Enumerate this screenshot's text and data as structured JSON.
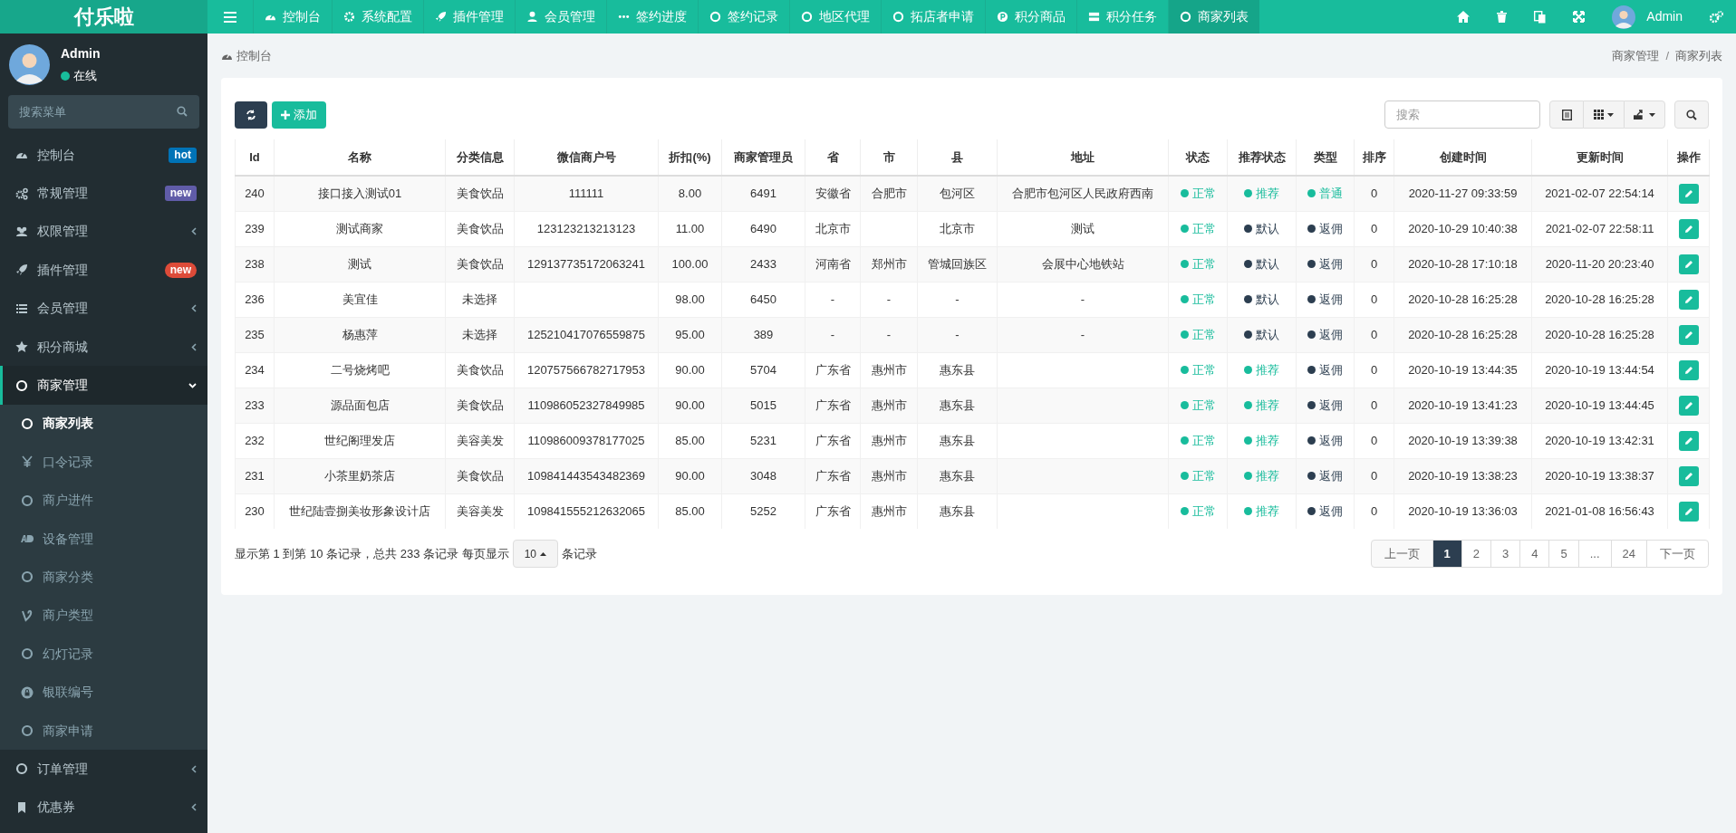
{
  "brand": "付乐啦",
  "topnav": [
    {
      "label": "控制台",
      "selected": false
    },
    {
      "label": "系统配置",
      "selected": false
    },
    {
      "label": "插件管理",
      "selected": false
    },
    {
      "label": "会员管理",
      "selected": false
    },
    {
      "label": "签约进度",
      "selected": false
    },
    {
      "label": "签约记录",
      "selected": false
    },
    {
      "label": "地区代理",
      "selected": false
    },
    {
      "label": "拓店者申请",
      "selected": false
    },
    {
      "label": "积分商品",
      "selected": false
    },
    {
      "label": "积分任务",
      "selected": false
    },
    {
      "label": "商家列表",
      "selected": true
    }
  ],
  "header_user": "Admin",
  "sidebar": {
    "user": {
      "name": "Admin",
      "status": "在线"
    },
    "search": {
      "placeholder": "搜索菜单"
    },
    "menu": [
      {
        "label": "控制台",
        "badge": {
          "text": "hot",
          "color": "#0073b7",
          "kind": "tag"
        }
      },
      {
        "label": "常规管理",
        "badge": {
          "text": "new",
          "color": "#605ca8",
          "kind": "tag"
        }
      },
      {
        "label": "权限管理",
        "expanded": false
      },
      {
        "label": "插件管理",
        "badge": {
          "text": "new",
          "color": "#dd4b39",
          "kind": "pill"
        }
      },
      {
        "label": "会员管理",
        "expanded": false
      },
      {
        "label": "积分商城",
        "expanded": false
      },
      {
        "label": "商家管理",
        "expanded": true,
        "children": [
          {
            "label": "商家列表",
            "selected": true
          },
          {
            "label": "口令记录",
            "selected": false
          },
          {
            "label": "商户进件",
            "selected": false
          },
          {
            "label": "设备管理",
            "selected": false
          },
          {
            "label": "商家分类",
            "selected": false
          },
          {
            "label": "商户类型",
            "selected": false
          },
          {
            "label": "幻灯记录",
            "selected": false
          },
          {
            "label": "银联编号",
            "selected": false
          },
          {
            "label": "商家申请",
            "selected": false
          }
        ]
      },
      {
        "label": "订单管理",
        "expanded": false
      },
      {
        "label": "优惠券",
        "expanded": false
      }
    ]
  },
  "breadcrumb": {
    "current": "控制台",
    "trail": [
      "商家管理",
      "商家列表"
    ],
    "separator": "/"
  },
  "toolbar": {
    "add_label": "添加",
    "search": {
      "placeholder": "搜索"
    }
  },
  "table": {
    "columns": [
      "Id",
      "名称",
      "分类信息",
      "微信商户号",
      "折扣(%)",
      "商家管理员",
      "省",
      "市",
      "县",
      "地址",
      "状态",
      "推荐状态",
      "类型",
      "排序",
      "创建时间",
      "更新时间",
      "操作"
    ],
    "rows": [
      {
        "id": "240",
        "name": "接口接入测试01",
        "category": "美食饮品",
        "wechat": "111111",
        "discount": "8.00",
        "admin": "6491",
        "province": "安徽省",
        "city": "合肥市",
        "county": "包河区",
        "address": "合肥市包河区人民政府西南",
        "status": {
          "text": "正常",
          "color": "#18bc9c"
        },
        "recommend": {
          "text": "推荐",
          "color": "#18bc9c"
        },
        "type": {
          "text": "普通",
          "color": "#18bc9c"
        },
        "sort": "0",
        "created": "2020-11-27 09:33:59",
        "updated": "2021-02-07 22:54:14"
      },
      {
        "id": "239",
        "name": "测试商家",
        "category": "美食饮品",
        "wechat": "123123213213123",
        "discount": "11.00",
        "admin": "6490",
        "province": "北京市",
        "county": "北京市",
        "address": "测试",
        "status": {
          "text": "正常",
          "color": "#18bc9c"
        },
        "recommend": {
          "text": "默认",
          "color": "#2c3e50"
        },
        "type": {
          "text": "返佣",
          "color": "#2c3e50"
        },
        "sort": "0",
        "created": "2020-10-29 10:40:38",
        "updated": "2021-02-07 22:58:11"
      },
      {
        "id": "238",
        "name": "测试",
        "category": "美食饮品",
        "wechat": "129137735172063241",
        "discount": "100.00",
        "admin": "2433",
        "province": "河南省",
        "city": "郑州市",
        "county": "管城回族区",
        "address": "会展中心地铁站",
        "status": {
          "text": "正常",
          "color": "#18bc9c"
        },
        "recommend": {
          "text": "默认",
          "color": "#2c3e50"
        },
        "type": {
          "text": "返佣",
          "color": "#2c3e50"
        },
        "sort": "0",
        "created": "2020-10-28 17:10:18",
        "updated": "2020-11-20 20:23:40"
      },
      {
        "id": "236",
        "name": "美宜佳",
        "category": "未选择",
        "discount": "98.00",
        "admin": "6450",
        "province": "-",
        "city": "-",
        "county": "-",
        "address": "-",
        "status": {
          "text": "正常",
          "color": "#18bc9c"
        },
        "recommend": {
          "text": "默认",
          "color": "#2c3e50"
        },
        "type": {
          "text": "返佣",
          "color": "#2c3e50"
        },
        "sort": "0",
        "created": "2020-10-28 16:25:28",
        "updated": "2020-10-28 16:25:28"
      },
      {
        "id": "235",
        "name": "杨惠萍",
        "category": "未选择",
        "wechat": "125210417076559875",
        "discount": "95.00",
        "admin": "389",
        "province": "-",
        "city": "-",
        "county": "-",
        "address": "-",
        "status": {
          "text": "正常",
          "color": "#18bc9c"
        },
        "recommend": {
          "text": "默认",
          "color": "#2c3e50"
        },
        "type": {
          "text": "返佣",
          "color": "#2c3e50"
        },
        "sort": "0",
        "created": "2020-10-28 16:25:28",
        "updated": "2020-10-28 16:25:28"
      },
      {
        "id": "234",
        "name": "二号烧烤吧",
        "category": "美食饮品",
        "wechat": "120757566782717953",
        "discount": "90.00",
        "admin": "5704",
        "province": "广东省",
        "city": "惠州市",
        "county": "惠东县",
        "status": {
          "text": "正常",
          "color": "#18bc9c"
        },
        "recommend": {
          "text": "推荐",
          "color": "#18bc9c"
        },
        "type": {
          "text": "返佣",
          "color": "#2c3e50"
        },
        "sort": "0",
        "created": "2020-10-19 13:44:35",
        "updated": "2020-10-19 13:44:54"
      },
      {
        "id": "233",
        "name": "源品面包店",
        "category": "美食饮品",
        "wechat": "110986052327849985",
        "discount": "90.00",
        "admin": "5015",
        "province": "广东省",
        "city": "惠州市",
        "county": "惠东县",
        "status": {
          "text": "正常",
          "color": "#18bc9c"
        },
        "recommend": {
          "text": "推荐",
          "color": "#18bc9c"
        },
        "type": {
          "text": "返佣",
          "color": "#2c3e50"
        },
        "sort": "0",
        "created": "2020-10-19 13:41:23",
        "updated": "2020-10-19 13:44:45"
      },
      {
        "id": "232",
        "name": "世纪阁理发店",
        "category": "美容美发",
        "wechat": "110986009378177025",
        "discount": "85.00",
        "admin": "5231",
        "province": "广东省",
        "city": "惠州市",
        "county": "惠东县",
        "status": {
          "text": "正常",
          "color": "#18bc9c"
        },
        "recommend": {
          "text": "推荐",
          "color": "#18bc9c"
        },
        "type": {
          "text": "返佣",
          "color": "#2c3e50"
        },
        "sort": "0",
        "created": "2020-10-19 13:39:38",
        "updated": "2020-10-19 13:42:31"
      },
      {
        "id": "231",
        "name": "小茶里奶茶店",
        "category": "美食饮品",
        "wechat": "109841443543482369",
        "discount": "90.00",
        "admin": "3048",
        "province": "广东省",
        "city": "惠州市",
        "county": "惠东县",
        "status": {
          "text": "正常",
          "color": "#18bc9c"
        },
        "recommend": {
          "text": "推荐",
          "color": "#18bc9c"
        },
        "type": {
          "text": "返佣",
          "color": "#2c3e50"
        },
        "sort": "0",
        "created": "2020-10-19 13:38:23",
        "updated": "2020-10-19 13:38:37"
      },
      {
        "id": "230",
        "name": "世纪陆壹捌美妆形象设计店",
        "category": "美容美发",
        "wechat": "109841555212632065",
        "discount": "85.00",
        "admin": "5252",
        "province": "广东省",
        "city": "惠州市",
        "county": "惠东县",
        "status": {
          "text": "正常",
          "color": "#18bc9c"
        },
        "recommend": {
          "text": "推荐",
          "color": "#18bc9c"
        },
        "type": {
          "text": "返佣",
          "color": "#2c3e50"
        },
        "sort": "0",
        "created": "2020-10-19 13:36:03",
        "updated": "2021-01-08 16:56:43"
      }
    ]
  },
  "pagination": {
    "summary": "显示第 1 到第 10 条记录，总共 233 条记录 每页显示",
    "page_size": "10",
    "suffix": "条记录",
    "prev": "上一页",
    "next": "下一页",
    "pages": [
      {
        "label": "1",
        "selected": true
      },
      {
        "label": "2",
        "selected": false
      },
      {
        "label": "3",
        "selected": false
      },
      {
        "label": "4",
        "selected": false
      },
      {
        "label": "5",
        "selected": false
      },
      {
        "label": "...",
        "selected": false
      },
      {
        "label": "24",
        "selected": false
      }
    ]
  }
}
